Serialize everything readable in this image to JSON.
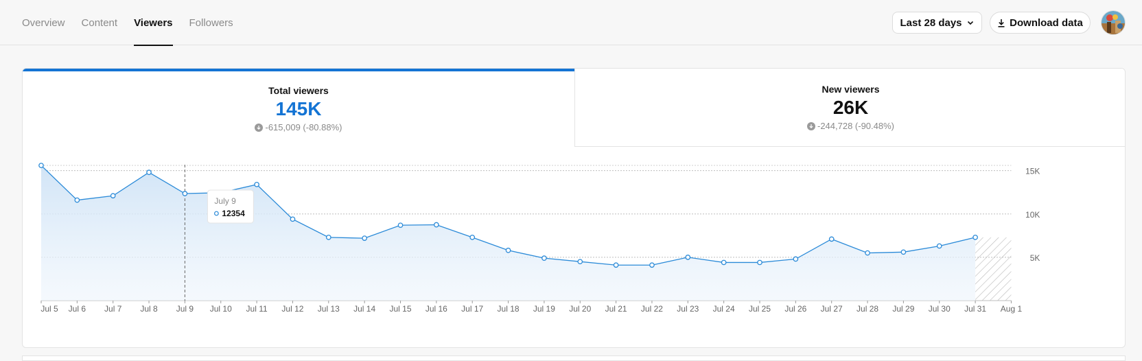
{
  "tabs": [
    {
      "label": "Overview",
      "active": false
    },
    {
      "label": "Content",
      "active": false
    },
    {
      "label": "Viewers",
      "active": true
    },
    {
      "label": "Followers",
      "active": false
    }
  ],
  "toolbar": {
    "range_label": "Last 28 days",
    "download_label": "Download data"
  },
  "metrics": {
    "total": {
      "label": "Total viewers",
      "value": "145K",
      "delta": "-615,009 (-80.88%)"
    },
    "new": {
      "label": "New viewers",
      "value": "26K",
      "delta": "-244,728 (-90.48%)"
    }
  },
  "tooltip": {
    "date": "July 9",
    "value": "12354"
  },
  "colors": {
    "accent": "#1474d4",
    "line": "#2a8ad8"
  },
  "chart_data": {
    "type": "area",
    "categories": [
      "Jul 5",
      "Jul 6",
      "Jul 7",
      "Jul 8",
      "Jul 9",
      "Jul 10",
      "Jul 11",
      "Jul 12",
      "Jul 13",
      "Jul 14",
      "Jul 15",
      "Jul 16",
      "Jul 17",
      "Jul 18",
      "Jul 19",
      "Jul 20",
      "Jul 21",
      "Jul 22",
      "Jul 23",
      "Jul 24",
      "Jul 25",
      "Jul 26",
      "Jul 27",
      "Jul 28",
      "Jul 29",
      "Jul 30",
      "Jul 31",
      "Aug 1"
    ],
    "values": [
      15600,
      11600,
      12100,
      14800,
      12354,
      12450,
      13400,
      9400,
      7300,
      7200,
      8700,
      8750,
      7300,
      5800,
      4900,
      4500,
      4100,
      4100,
      5000,
      4400,
      4400,
      4800,
      7100,
      5500,
      5600,
      6300,
      7300,
      null
    ],
    "y_ticks": [
      "5K",
      "10K",
      "15K"
    ],
    "ylim": [
      0,
      16000
    ],
    "grid": true,
    "incomplete_last_period": true
  }
}
